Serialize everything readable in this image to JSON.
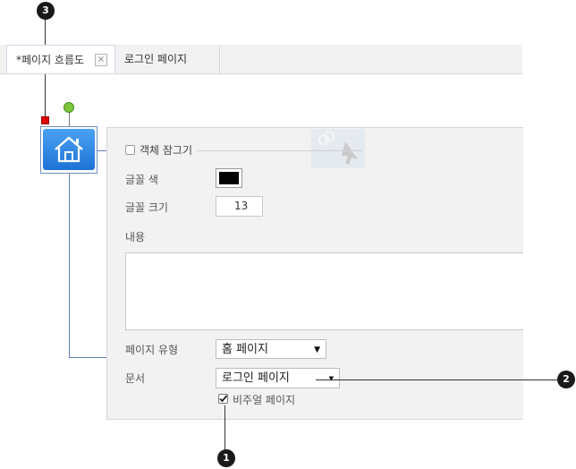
{
  "callouts": {
    "c1": "1",
    "c2": "2",
    "c3": "3"
  },
  "tabs": [
    {
      "label": "*페이지 흐름도",
      "close": "×"
    },
    {
      "label": "로그인 페이지"
    }
  ],
  "node": {
    "icon": "home-icon"
  },
  "panel": {
    "lock_label": "객체 잠그기",
    "font_color_label": "글꼴 색",
    "font_color_value": "#000000",
    "font_size_label": "글꼴 크기",
    "font_size_value": "13",
    "content_label": "내용",
    "content_value": "",
    "page_type_label": "페이지 유형",
    "page_type_value": "홈 페이지",
    "document_label": "문서",
    "document_value": "로그인 페이지",
    "visual_page_label": "비주얼 페이지",
    "visual_page_checked": true
  },
  "colors": {
    "accent": "#1e73d6",
    "handle_green": "#7cc73c",
    "handle_red": "#e00000"
  }
}
